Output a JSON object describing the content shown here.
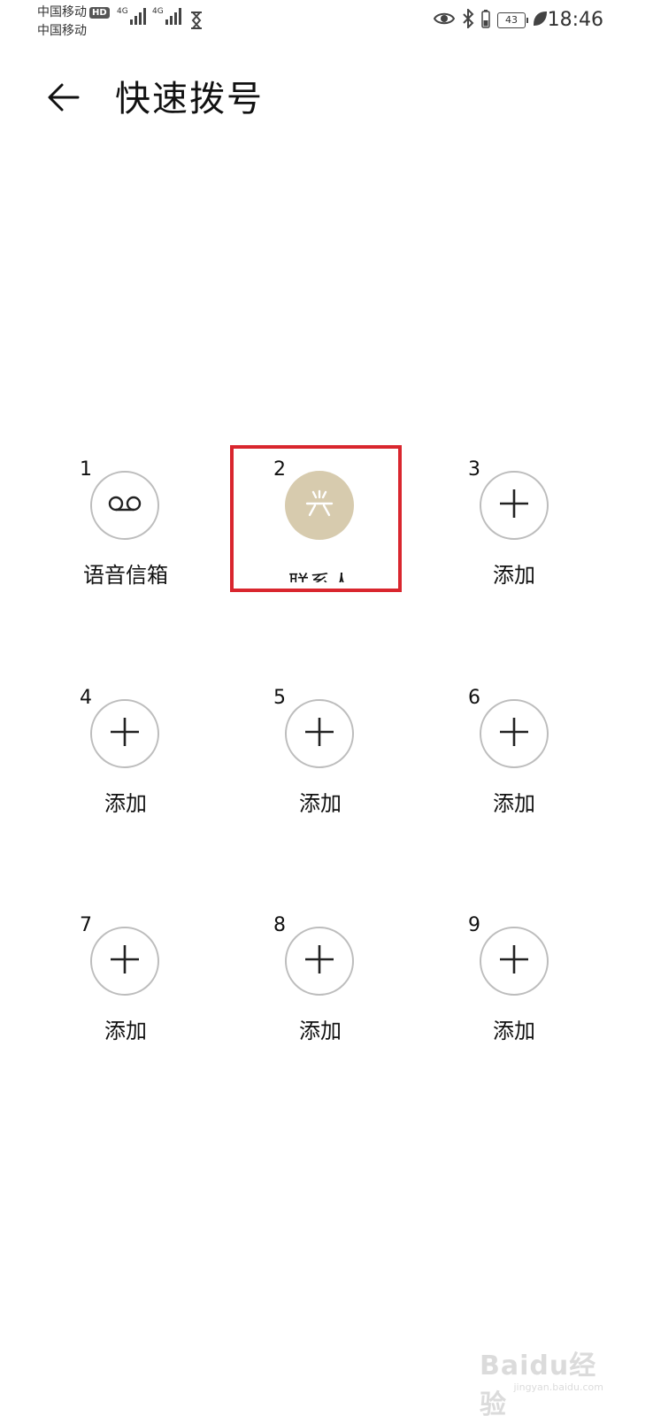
{
  "status_bar": {
    "carrier1": "中国移动",
    "hd_badge": "HD",
    "carrier2": "中国移动",
    "network1": "4G",
    "network2": "4G",
    "battery_level": "43",
    "time": "18:46",
    "icons": [
      "signal-icon",
      "hourglass-icon",
      "eye-icon",
      "bluetooth-icon",
      "battery-icon",
      "leaf-icon"
    ]
  },
  "header": {
    "title": "快速拨号",
    "back_icon": "back-arrow-icon"
  },
  "speed_dial": [
    {
      "number": "1",
      "label": "语音信箱",
      "icon": "voicemail-icon",
      "type": "voicemail"
    },
    {
      "number": "2",
      "label": "联系人",
      "icon": "contact-avatar-icon",
      "type": "contact"
    },
    {
      "number": "3",
      "label": "添加",
      "icon": "plus-icon",
      "type": "add"
    },
    {
      "number": "4",
      "label": "添加",
      "icon": "plus-icon",
      "type": "add"
    },
    {
      "number": "5",
      "label": "添加",
      "icon": "plus-icon",
      "type": "add"
    },
    {
      "number": "6",
      "label": "添加",
      "icon": "plus-icon",
      "type": "add"
    },
    {
      "number": "7",
      "label": "添加",
      "icon": "plus-icon",
      "type": "add"
    },
    {
      "number": "8",
      "label": "添加",
      "icon": "plus-icon",
      "type": "add"
    },
    {
      "number": "9",
      "label": "添加",
      "icon": "plus-icon",
      "type": "add"
    }
  ],
  "colors": {
    "contact_avatar": "#d7cbae",
    "highlight": "#d9262e",
    "circle_border": "#bdbdbd"
  },
  "watermark": {
    "text": "Baidu经验",
    "sub": "jingyan.baidu.com"
  }
}
